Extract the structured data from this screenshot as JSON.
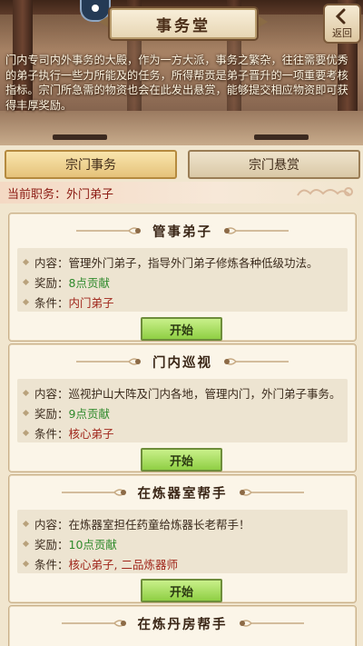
{
  "header": {
    "title": "事务堂",
    "back_label": "返回",
    "intro": "门内专司内外事务的大殿，作为一方大派，事务之繁杂，往往需要优秀的弟子执行一些力所能及的任务，所得帮贡是弟子晋升的一项重要考核指标。宗门所急需的物资也会在此发出悬赏，能够提交相应物资即可获得丰厚奖励。"
  },
  "tabs": [
    {
      "label": "宗门事务",
      "active": true
    },
    {
      "label": "宗门悬赏",
      "active": false
    }
  ],
  "current_post": {
    "label": "当前职务：",
    "value": "外门弟子"
  },
  "quest_labels": {
    "content": "内容：",
    "reward": "奖励：",
    "condition": "条件："
  },
  "quests": [
    {
      "title": "管事弟子",
      "content": "管理外门弟子，指导外门弟子修炼各种低级功法。",
      "reward": "8点贡献",
      "condition": "内门弟子",
      "button": "开始"
    },
    {
      "title": "门内巡视",
      "content": "巡视护山大阵及门内各地，管理内门，外门弟子事务。",
      "reward": "9点贡献",
      "condition": "核心弟子",
      "button": "开始"
    },
    {
      "title": "在炼器室帮手",
      "content": "在炼器室担任药童给炼器长老帮手！",
      "reward": "10点贡献",
      "condition": "核心弟子, 二品炼器师",
      "button": "开始"
    },
    {
      "title": "在炼丹房帮手"
    }
  ],
  "colors": {
    "reward": "#2f8a2c",
    "condition": "#a0261b",
    "start_button": "#a8dd5e"
  }
}
